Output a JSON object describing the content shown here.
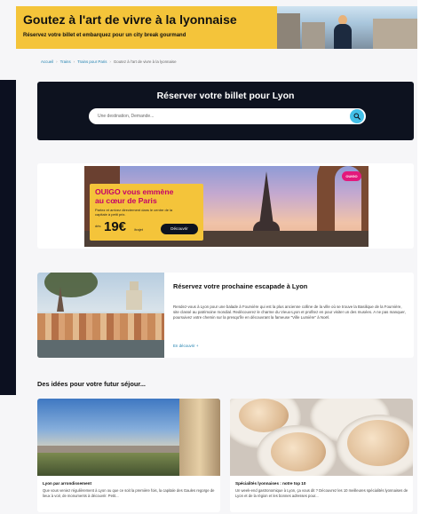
{
  "banner": {
    "title": "Goutez à l'art de vivre à la lyonnaise",
    "subtitle": "Réservez votre billet et embarquez pour un city break gourmand"
  },
  "breadcrumb": {
    "items": [
      "Accueil",
      "Trains",
      "Trains pour Paris",
      "Goutez à l'art de vivre à la lyonnaise"
    ]
  },
  "booking": {
    "title": "Réserver votre billet pour Lyon",
    "search_placeholder": "Une destination, Demande..."
  },
  "ad": {
    "brand": "OUIGO",
    "heading": "OUIGO vous emmène au cœur de Paris",
    "body": "Partez et arrivez directement dans le centre de la capitale à petit prix.",
    "price_prefix": "dès",
    "price": "19€",
    "price_suffix": "/trajet",
    "cta": "Découvrir"
  },
  "feature": {
    "title": "Réservez votre prochaine escapade à Lyon",
    "body": "Rendez-vous à Lyon pour une balade à Fourvière qui est la plus ancienne colline de la ville où se trouve la Basilique de la Fourvière, site classé au patrimoine mondial. Redécouvrez le charme du Vieux-Lyon et profitez en pour visiter un des musées. A ne pas manquer, poursuivez votre chemin sur la presqu'île en découvrant la fameuse \"Ville Lumière\" à Noël.",
    "link": "En découvrir +"
  },
  "ideas": {
    "heading": "Des idées pour votre futur séjour...",
    "cards": [
      {
        "title": "Lyon par arrondissement",
        "desc": "Que vous veniez régulièrement à Lyon ou que ce soit la première fois, la capitale des Gaules regorge de lieux à voir, de monuments à découvrir. Petit..."
      },
      {
        "title": "Spécialités lyonnaises : notre top 10",
        "desc": "Un week-end gastronomique à Lyon, ça vous dit ? Découvrez les 10 meilleures spécialités lyonnaises de Lyon et de la région et les bonnes adresses pour..."
      }
    ]
  },
  "colors": {
    "accent_yellow": "#f4c43a",
    "panel_dark": "#0d121f",
    "search_button": "#43c0e8",
    "link_blue": "#1d7fae",
    "ouigo_pink": "#c4006a"
  },
  "icons": {
    "search": "search-icon"
  }
}
